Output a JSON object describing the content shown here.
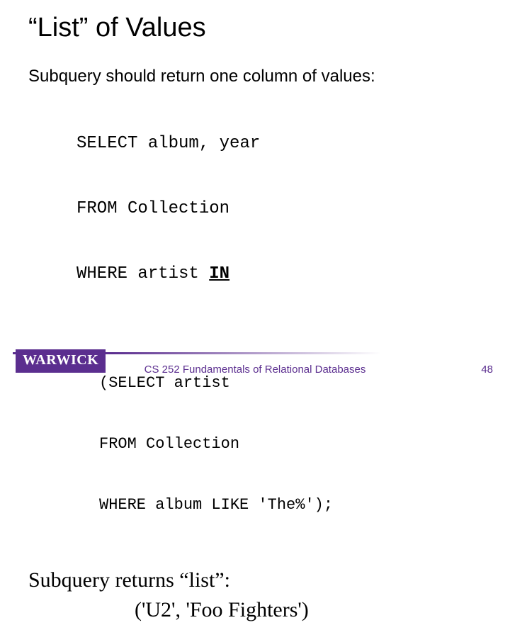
{
  "title": "“List” of Values",
  "intro": "Subquery should return one column of values:",
  "sql1": {
    "l1": "SELECT album, year",
    "l2": "FROM Collection",
    "l3a": "WHERE artist ",
    "l3kw": "IN"
  },
  "sql2": {
    "l1": "(SELECT artist",
    "l2": "FROM Collection",
    "l3": "WHERE album LIKE 'The%');"
  },
  "returns": "Subquery returns “list”:",
  "listval": "('U2', 'Foo Fighters')",
  "logo": "WARWICK",
  "footer": "CS 252 Fundamentals of Relational Databases",
  "pagenum": "48"
}
